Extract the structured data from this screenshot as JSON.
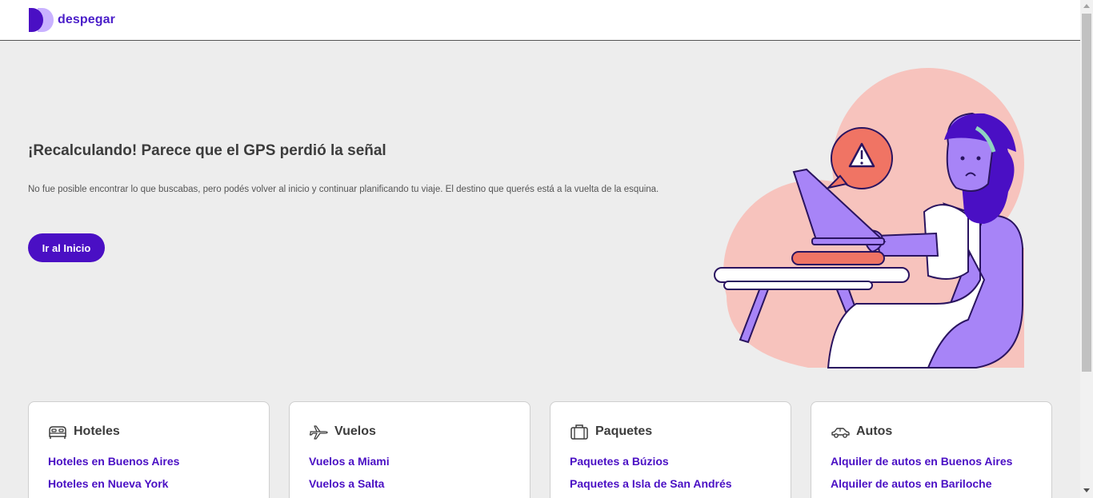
{
  "header": {
    "brand": "despegar",
    "logo_icon": "despegar-logo-icon",
    "brand_color": "#4a1ec9"
  },
  "hero": {
    "title": "¡Recalculando! Parece que el GPS perdió la señal",
    "description": "No fue posible encontrar lo que buscabas, pero podés volver al inicio y continuar planificando tu viaje. El destino que querés está a la vuelta de la esquina.",
    "cta_label": "Ir al Inicio",
    "cta_color": "#4a0fc4"
  },
  "cards": [
    {
      "icon": "bed-icon",
      "title": "Hoteles",
      "links": [
        "Hoteles en Buenos Aires",
        "Hoteles en Nueva York"
      ]
    },
    {
      "icon": "plane-icon",
      "title": "Vuelos",
      "links": [
        "Vuelos a Miami",
        "Vuelos a Salta"
      ]
    },
    {
      "icon": "suitcase-icon",
      "title": "Paquetes",
      "links": [
        "Paquetes a Búzios",
        "Paquetes a Isla de San Andrés"
      ]
    },
    {
      "icon": "car-icon",
      "title": "Autos",
      "links": [
        "Alquiler de autos en Buenos Aires",
        "Alquiler de autos en Bariloche"
      ]
    }
  ],
  "colors": {
    "background": "#ededed",
    "link": "#4a0fc4",
    "illustration_pink": "#f7c3bd",
    "illustration_purple": "#a784f7"
  }
}
